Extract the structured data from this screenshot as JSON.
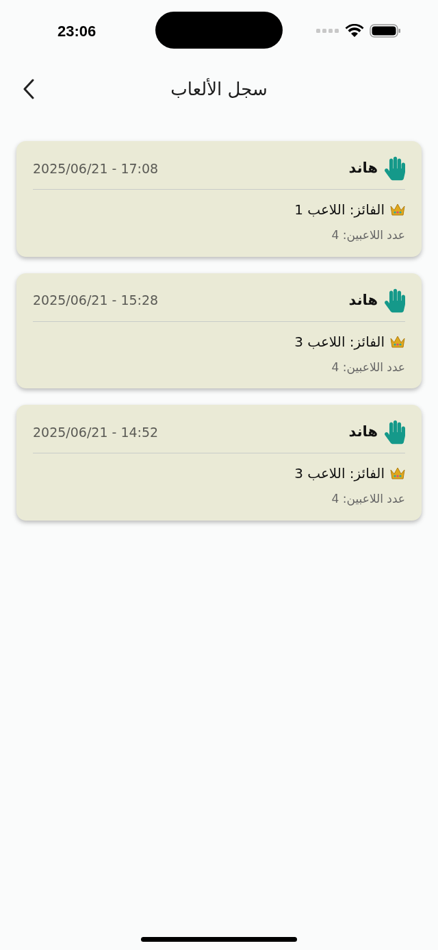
{
  "status_bar": {
    "time": "23:06"
  },
  "header": {
    "title": "سجل الألعاب"
  },
  "games": [
    {
      "name": "هاند",
      "datetime": "2025/06/21 - 17:08",
      "winner": "الفائز: اللاعب 1",
      "players": "عدد اللاعبين: 4"
    },
    {
      "name": "هاند",
      "datetime": "2025/06/21 - 15:28",
      "winner": "الفائز: اللاعب 3",
      "players": "عدد اللاعبين: 4"
    },
    {
      "name": "هاند",
      "datetime": "2025/06/21 - 14:52",
      "winner": "الفائز: اللاعب 3",
      "players": "عدد اللاعبين: 4"
    }
  ]
}
